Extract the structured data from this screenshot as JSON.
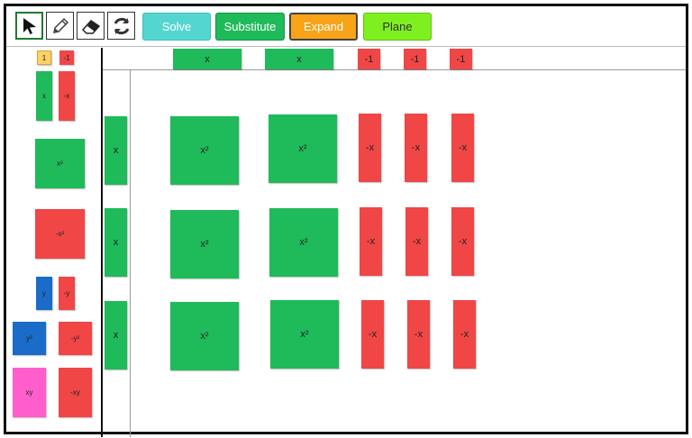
{
  "toolbar": {
    "tools": [
      "pointer-icon",
      "pencil-icon",
      "eraser-icon",
      "refresh-icon"
    ],
    "buttons": {
      "solve": "Solve",
      "substitute": "Substitute",
      "expand": "Expand",
      "plane": "Plane"
    }
  },
  "palette": {
    "unit_pos": "1",
    "unit_neg": "-1",
    "x_pos": "x",
    "x_neg": "-x",
    "x2_pos": "x²",
    "x2_neg": "-x²",
    "y_pos": "y",
    "y_neg": "-y",
    "y2_pos": "y²",
    "y2_neg": "-y²",
    "xy_pos": "xy",
    "xy_neg": "-xy"
  },
  "workspace": {
    "top_labels": [
      "x",
      "x",
      "-1",
      "-1",
      "-1"
    ],
    "left_labels": [
      "x",
      "x",
      "x"
    ],
    "grid": [
      [
        "x²",
        "x²",
        "-x",
        "-x",
        "-x"
      ],
      [
        "x²",
        "x²",
        "-x",
        "-x",
        "-x"
      ],
      [
        "x²",
        "x²",
        "-x",
        "-x",
        "-x"
      ]
    ]
  },
  "colors": {
    "positive": "#1fba5a",
    "negative": "#f04646",
    "y_tile": "#1a6cc8",
    "xy_tile": "#ff5ecb"
  }
}
